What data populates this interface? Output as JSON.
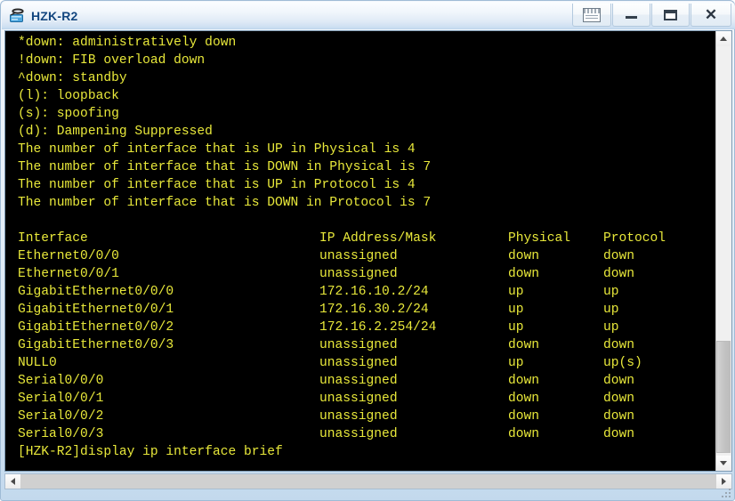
{
  "window": {
    "title": "HZK-R2",
    "icon": "router-device-icon",
    "buttons": [
      {
        "name": "help-button",
        "icon": "document-window-icon",
        "label": ""
      },
      {
        "name": "minimize-button",
        "icon": "minimize-icon",
        "label": ""
      },
      {
        "name": "maximize-button",
        "icon": "maximize-icon",
        "label": ""
      },
      {
        "name": "close-button",
        "icon": "close-icon",
        "label": "✕"
      }
    ],
    "colors": {
      "titlebar_text": "#11457f",
      "terminal_background": "#000000",
      "terminal_text": "#e8e83a",
      "frame": "#c3d9ed"
    }
  },
  "terminal": {
    "legend": [
      "*down: administratively down",
      "!down: FIB overload down",
      "^down: standby",
      "(l): loopback",
      "(s): spoofing",
      "(d): Dampening Suppressed"
    ],
    "counts": [
      "The number of interface that is UP in Physical is 4",
      "The number of interface that is DOWN in Physical is 7",
      "The number of interface that is UP in Protocol is 4",
      "The number of interface that is DOWN in Protocol is 7"
    ],
    "table": {
      "headers": {
        "interface": "Interface",
        "ip": "IP Address/Mask",
        "physical": "Physical",
        "protocol": "Protocol"
      },
      "rows": [
        {
          "interface": "Ethernet0/0/0",
          "ip": "unassigned",
          "physical": "down",
          "protocol": "down"
        },
        {
          "interface": "Ethernet0/0/1",
          "ip": "unassigned",
          "physical": "down",
          "protocol": "down"
        },
        {
          "interface": "GigabitEthernet0/0/0",
          "ip": "172.16.10.2/24",
          "physical": "up",
          "protocol": "up"
        },
        {
          "interface": "GigabitEthernet0/0/1",
          "ip": "172.16.30.2/24",
          "physical": "up",
          "protocol": "up"
        },
        {
          "interface": "GigabitEthernet0/0/2",
          "ip": "172.16.2.254/24",
          "physical": "up",
          "protocol": "up"
        },
        {
          "interface": "GigabitEthernet0/0/3",
          "ip": "unassigned",
          "physical": "down",
          "protocol": "down"
        },
        {
          "interface": "NULL0",
          "ip": "unassigned",
          "physical": "up",
          "protocol": "up(s)"
        },
        {
          "interface": "Serial0/0/0",
          "ip": "unassigned",
          "physical": "down",
          "protocol": "down"
        },
        {
          "interface": "Serial0/0/1",
          "ip": "unassigned",
          "physical": "down",
          "protocol": "down"
        },
        {
          "interface": "Serial0/0/2",
          "ip": "unassigned",
          "physical": "down",
          "protocol": "down"
        },
        {
          "interface": "Serial0/0/3",
          "ip": "unassigned",
          "physical": "down",
          "protocol": "down"
        }
      ]
    },
    "prompt_line": "[HZK-R2]display ip interface brief"
  },
  "scrollbars": {
    "vertical": {
      "up_arrow": "chevron-up-icon",
      "down_arrow": "chevron-down-icon"
    },
    "horizontal": {
      "left_arrow": "chevron-left-icon",
      "right_arrow": "chevron-right-icon"
    }
  }
}
